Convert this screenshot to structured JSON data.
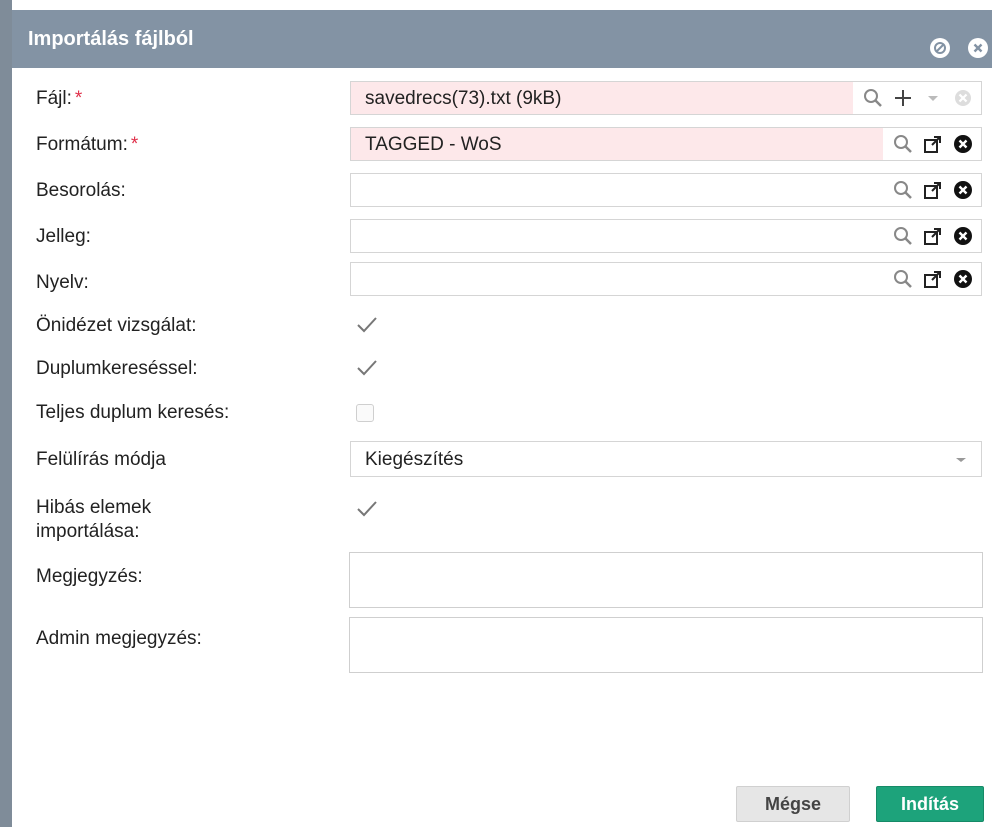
{
  "window": {
    "title": "Importálás fájlból"
  },
  "colors": {
    "titlebar": "#8393a4",
    "required_bg": "#fde8ea",
    "required_star": "#e0304a",
    "start_button": "#1da37b"
  },
  "fields": {
    "file": {
      "label": "Fájl:",
      "required_mark": "*",
      "value": "savedrecs(73).txt (9kB)"
    },
    "format": {
      "label": "Formátum:",
      "required_mark": "*",
      "value": "TAGGED - WoS"
    },
    "classification": {
      "label": "Besorolás:",
      "value": ""
    },
    "nature": {
      "label": "Jelleg:",
      "value": ""
    },
    "language": {
      "label": "Nyelv:",
      "value": ""
    },
    "self_citation": {
      "label": "Önidézet vizsgálat:",
      "checked": true
    },
    "duplicate_search": {
      "label": "Duplumkereséssel:",
      "checked": true
    },
    "full_duplicate_search": {
      "label": "Teljes duplum keresés:",
      "checked": false
    },
    "overwrite_mode": {
      "label": "Felülírás módja",
      "value": "Kiegészítés"
    },
    "import_faulty": {
      "label_line1": "Hibás elemek",
      "label_line2": "importálása:",
      "checked": true
    },
    "note": {
      "label": "Megjegyzés:",
      "value": ""
    },
    "admin_note": {
      "label": "Admin megjegyzés:",
      "value": ""
    }
  },
  "buttons": {
    "cancel": "Mégse",
    "start": "Indítás"
  }
}
